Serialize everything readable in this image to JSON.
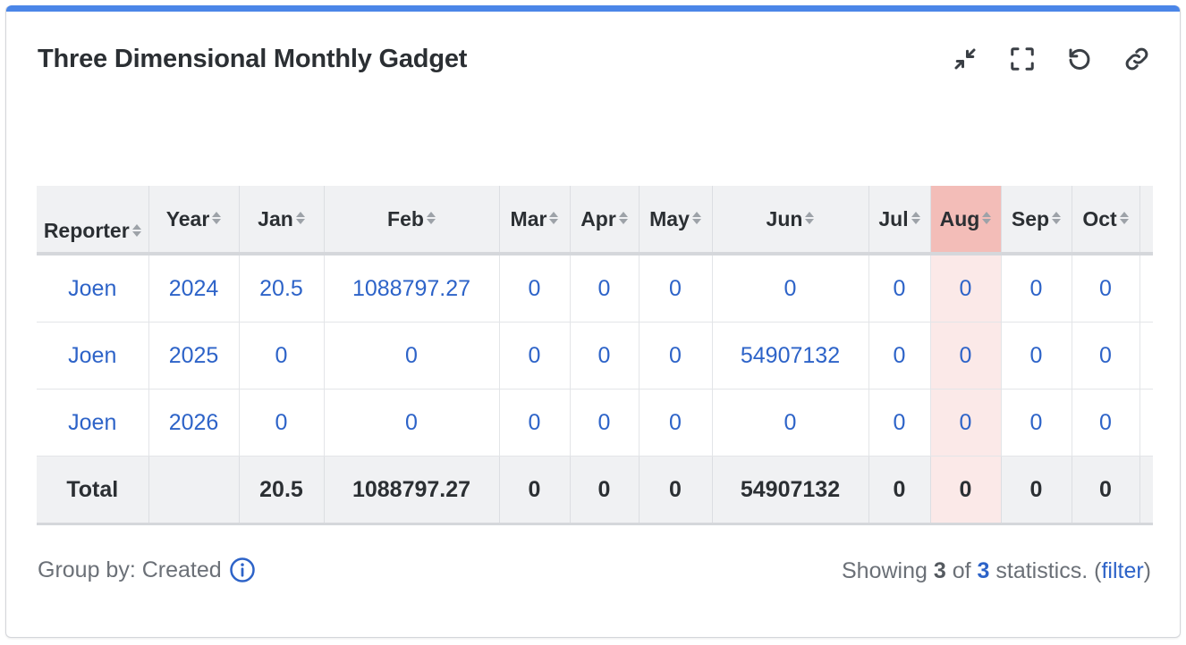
{
  "gadget": {
    "title": "Three Dimensional Monthly Gadget",
    "accent_color": "#4b86e8",
    "highlight_color": "#f3bdb8",
    "actions": [
      {
        "icon": "minimize-icon"
      },
      {
        "icon": "fullscreen-icon"
      },
      {
        "icon": "refresh-icon"
      },
      {
        "icon": "link-icon"
      }
    ]
  },
  "table": {
    "headers": [
      "Reporter",
      "Year",
      "Jan",
      "Feb",
      "Mar",
      "Apr",
      "May",
      "Jun",
      "Jul",
      "Aug",
      "Sep",
      "Oct"
    ],
    "highlighted_column": "Aug",
    "rows": [
      [
        "Joen",
        "2024",
        "20.5",
        "1088797.27",
        "0",
        "0",
        "0",
        "0",
        "0",
        "0",
        "0",
        "0"
      ],
      [
        "Joen",
        "2025",
        "0",
        "0",
        "0",
        "0",
        "0",
        "54907132",
        "0",
        "0",
        "0",
        "0"
      ],
      [
        "Joen",
        "2026",
        "0",
        "0",
        "0",
        "0",
        "0",
        "0",
        "0",
        "0",
        "0",
        "0"
      ]
    ],
    "total_row": [
      "Total",
      "",
      "20.5",
      "1088797.27",
      "0",
      "0",
      "0",
      "54907132",
      "0",
      "0",
      "0",
      "0"
    ]
  },
  "footer": {
    "group_by_label": "Group by: Created",
    "showing_prefix": "Showing ",
    "shown_count": "3",
    "of_text": " of ",
    "total_count": "3",
    "suffix": " statistics. (",
    "filter_link": "filter",
    "close_paren": ")"
  }
}
